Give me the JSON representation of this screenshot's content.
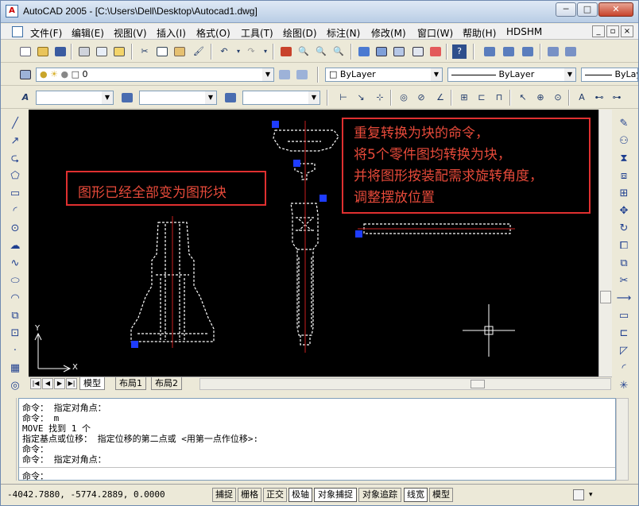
{
  "window": {
    "title": "AutoCAD 2005 - [C:\\Users\\Dell\\Desktop\\Autocad1.dwg]",
    "minimize": "─",
    "maximize": "□",
    "close": "✕"
  },
  "menubar": {
    "items": [
      "文件(F)",
      "编辑(E)",
      "视图(V)",
      "插入(I)",
      "格式(O)",
      "工具(T)",
      "绘图(D)",
      "标注(N)",
      "修改(M)",
      "窗口(W)",
      "帮助(H)",
      "HDSHM"
    ],
    "doc_min": "_",
    "doc_restore": "▫",
    "doc_close": "×"
  },
  "layers_toolbar": {
    "layer_value": "0",
    "color_value": "ByLayer",
    "linetype_value": "ByLayer",
    "lineweight_value": "ByLay"
  },
  "canvas": {
    "note_left": "图形已经全部变为图形块",
    "note_right_lines": [
      "重复转换为块的命令，",
      "将5个零件图均转换为块，",
      "并将图形按装配需求旋转角度，",
      "调整摆放位置"
    ],
    "ucs_x": "X",
    "ucs_y": "Y"
  },
  "layout_tabs": [
    "模型",
    "布局1",
    "布局2"
  ],
  "command_lines": [
    "命令： 指定对角点：",
    "命令： m",
    "MOVE 找到 1 个",
    "指定基点或位移： 指定位移的第二点或 <用第一点作位移>:",
    "命令：",
    "命令： 指定对角点："
  ],
  "command_prompt": "命令：",
  "status": {
    "coordinates": "-4042.7880, -5774.2889, 0.0000",
    "buttons": [
      {
        "label": "捕捉",
        "on": false
      },
      {
        "label": "栅格",
        "on": false
      },
      {
        "label": "正交",
        "on": false
      },
      {
        "label": "极轴",
        "on": true
      },
      {
        "label": "对象捕捉",
        "on": true
      },
      {
        "label": "对象追踪",
        "on": false
      },
      {
        "label": "线宽",
        "on": true
      },
      {
        "label": "模型",
        "on": false
      }
    ]
  },
  "colors": {
    "canvas_bg": "#000000",
    "note_border": "#e03030",
    "note_text": "#e74a3a",
    "grip": "#1e3cff",
    "axis_line": "#c81e1e"
  }
}
